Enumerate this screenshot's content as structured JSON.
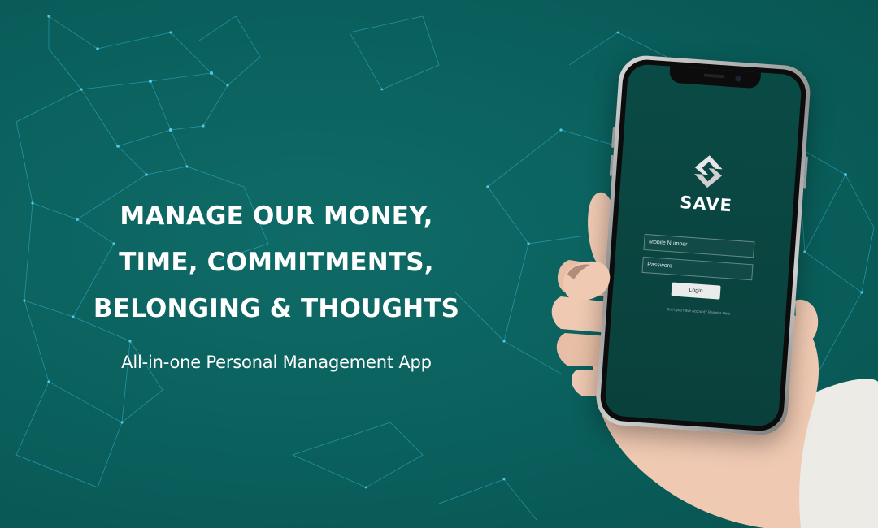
{
  "hero": {
    "headline_lines": [
      "MANAGE OUR MONEY,",
      "TIME, COMMITMENTS,",
      "BELONGING & THOUGHTS"
    ],
    "subtitle": "All-in-one Personal Management App"
  },
  "phone_app": {
    "name": "SAVE",
    "logo_icon": "save-logo-icon",
    "mobile_placeholder": "Mobile Number",
    "password_placeholder": "Password",
    "login_label": "Login",
    "signup_note": "Don't you have account? Register Here"
  },
  "colors": {
    "background": "#0a5f5c",
    "screen": "#0a4a45",
    "network_lines": "#3fc6e6",
    "text": "#ffffff"
  }
}
